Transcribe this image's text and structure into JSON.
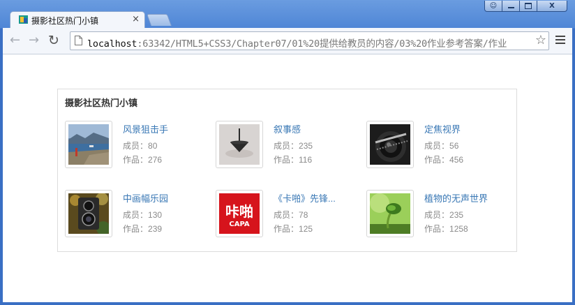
{
  "browser": {
    "tab_title": "摄影社区热门小镇",
    "tab_close": "×",
    "url_host": "localhost",
    "url_rest": ":63342/HTML5+CSS3/Chapter07/01%20提供给教员的内容/03%20作业参考答案/作业",
    "controls": {
      "user": "⍝",
      "minimize": "—",
      "maximize": "□",
      "close": "X"
    },
    "nav": {
      "back": "←",
      "forward": "→",
      "reload": "↻",
      "star": "☆"
    }
  },
  "panel": {
    "title": "摄影社区热门小镇",
    "members_label": "成员：",
    "works_label": "作品：",
    "groups": [
      {
        "name": "风景狙击手",
        "members": "80",
        "works": "276",
        "thumb": "landscape-photo"
      },
      {
        "name": "叙事感",
        "members": "235",
        "works": "116",
        "thumb": "spinning-top-photo"
      },
      {
        "name": "定焦视界",
        "members": "56",
        "works": "456",
        "thumb": "camera-lens-photo"
      },
      {
        "name": "中画幅乐园",
        "members": "130",
        "works": "239",
        "thumb": "twin-lens-camera-photo"
      },
      {
        "name": "《卡啪》先锋...",
        "members": "78",
        "works": "125",
        "thumb": "capa-logo"
      },
      {
        "name": "植物的无声世界",
        "members": "235",
        "works": "1258",
        "thumb": "sprout-photo"
      }
    ]
  },
  "logo_text": {
    "capa_cn": "咔啪",
    "capa_en": "CAPA"
  }
}
